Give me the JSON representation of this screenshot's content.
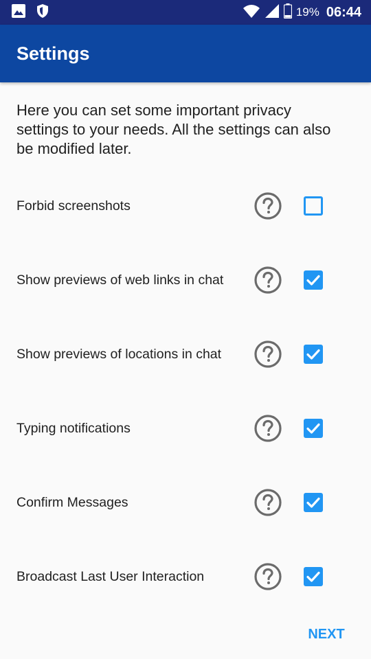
{
  "status_bar": {
    "icons": [
      "image-icon",
      "shield-icon",
      "wifi-icon",
      "signal-icon",
      "battery-icon"
    ],
    "battery": "19%",
    "time": "06:44"
  },
  "app_bar": {
    "title": "Settings",
    "color": "#0d47a1"
  },
  "intro": "Here you can set some important privacy settings to your needs. All the settings can also be modified later.",
  "settings": [
    {
      "label": "Forbid screenshots",
      "checked": false
    },
    {
      "label": "Show previews of web links in chat",
      "checked": true
    },
    {
      "label": "Show previews of locations in chat",
      "checked": true
    },
    {
      "label": "Typing notifications",
      "checked": true
    },
    {
      "label": "Confirm Messages",
      "checked": true
    },
    {
      "label": "Broadcast Last User Interaction",
      "checked": true
    }
  ],
  "next_label": "NEXT",
  "accent_color": "#2196f3"
}
